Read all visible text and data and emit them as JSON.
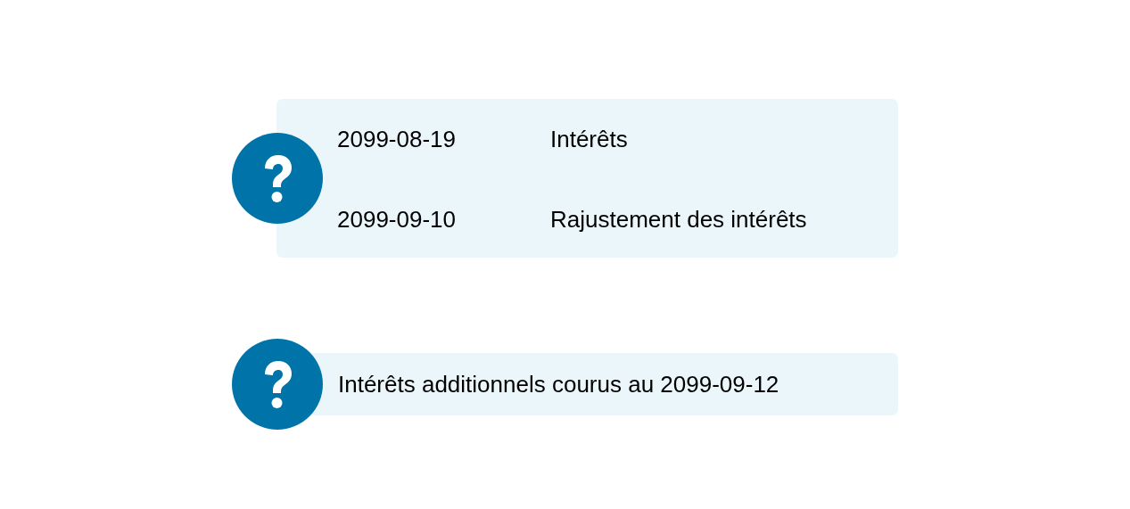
{
  "notes": [
    {
      "kind": "table",
      "rows": [
        {
          "date": "2099-08-19",
          "label": "Intérêts"
        },
        {
          "date": "2099-09-10",
          "label": "Rajustement des intérêts"
        }
      ]
    },
    {
      "kind": "text",
      "text": "Intérêts additionnels courus au 2099-09-12"
    }
  ]
}
